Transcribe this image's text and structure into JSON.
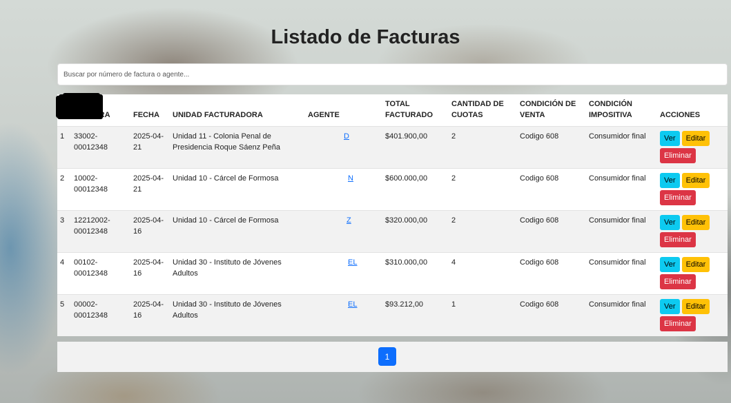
{
  "page": {
    "title": "Listado de Facturas"
  },
  "search": {
    "placeholder": "Buscar por número de factura o agente...",
    "value": ""
  },
  "table": {
    "headers": {
      "index": "#",
      "nro_factura": "NRO. FACTURA",
      "fecha": "FECHA",
      "unidad": "UNIDAD FACTURADORA",
      "agente": "AGENTE",
      "total": "TOTAL FACTURADO",
      "cuotas": "CANTIDAD DE CUOTAS",
      "condicion_venta": "CONDICIÓN DE VENTA",
      "condicion_impositiva": "CONDICIÓN IMPOSITIVA",
      "acciones": "ACCIONES"
    },
    "rows": [
      {
        "index": "1",
        "nro_factura": "33002-00012348",
        "fecha": "2025-04-21",
        "unidad": "Unidad 11 - Colonia Penal de Presidencia Roque Sáenz Peña",
        "agente": "D",
        "total": "$401.900,00",
        "cuotas": "2",
        "condicion_venta": "Codigo 608",
        "condicion_impositiva": "Consumidor final"
      },
      {
        "index": "2",
        "nro_factura": "10002-00012348",
        "fecha": "2025-04-21",
        "unidad": "Unidad 10 - Cárcel de Formosa",
        "agente": "N",
        "total": "$600.000,00",
        "cuotas": "2",
        "condicion_venta": "Codigo 608",
        "condicion_impositiva": "Consumidor final"
      },
      {
        "index": "3",
        "nro_factura": "12212002-00012348",
        "fecha": "2025-04-16",
        "unidad": "Unidad 10 - Cárcel de Formosa",
        "agente": "Z",
        "total": "$320.000,00",
        "cuotas": "2",
        "condicion_venta": "Codigo 608",
        "condicion_impositiva": "Consumidor final"
      },
      {
        "index": "4",
        "nro_factura": "00102-00012348",
        "fecha": "2025-04-16",
        "unidad": "Unidad 30 - Instituto de Jóvenes Adultos",
        "agente": "EL",
        "total": "$310.000,00",
        "cuotas": "4",
        "condicion_venta": "Codigo 608",
        "condicion_impositiva": "Consumidor final"
      },
      {
        "index": "5",
        "nro_factura": "00002-00012348",
        "fecha": "2025-04-16",
        "unidad": "Unidad 30 - Instituto de Jóvenes Adultos",
        "agente": "EL",
        "total": "$93.212,00",
        "cuotas": "1",
        "condicion_venta": "Codigo 608",
        "condicion_impositiva": "Consumidor final"
      }
    ],
    "actions": {
      "ver": "Ver",
      "editar": "Editar",
      "eliminar": "Eliminar"
    }
  },
  "pagination": {
    "current_page": "1"
  },
  "colors": {
    "ver": "#0dcaf0",
    "editar": "#ffc107",
    "eliminar": "#dc3545",
    "primary": "#0d6efd"
  }
}
